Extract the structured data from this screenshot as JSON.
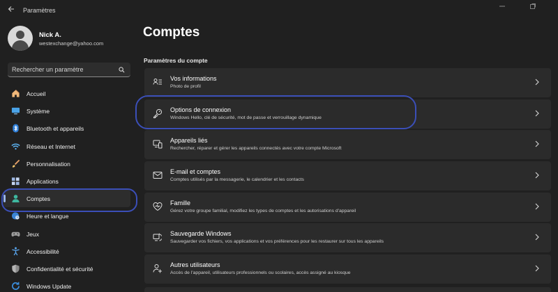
{
  "window": {
    "title": "Paramètres"
  },
  "user": {
    "name": "Nick A.",
    "email": "westexchange@yahoo.com"
  },
  "search": {
    "placeholder": "Rechercher un paramètre"
  },
  "nav": {
    "items": [
      {
        "label": "Accueil",
        "icon": "home-icon"
      },
      {
        "label": "Système",
        "icon": "monitor-icon"
      },
      {
        "label": "Bluetooth et appareils",
        "icon": "bluetooth-icon"
      },
      {
        "label": "Réseau et Internet",
        "icon": "wifi-icon"
      },
      {
        "label": "Personnalisation",
        "icon": "brush-icon"
      },
      {
        "label": "Applications",
        "icon": "apps-icon"
      },
      {
        "label": "Comptes",
        "icon": "person-icon",
        "selected": true
      },
      {
        "label": "Heure et langue",
        "icon": "clock-globe-icon"
      },
      {
        "label": "Jeux",
        "icon": "gamepad-icon"
      },
      {
        "label": "Accessibilité",
        "icon": "accessibility-icon"
      },
      {
        "label": "Confidentialité et sécurité",
        "icon": "shield-icon"
      },
      {
        "label": "Windows Update",
        "icon": "update-icon"
      }
    ]
  },
  "main": {
    "title": "Comptes",
    "section_title": "Paramètres du compte",
    "cards": [
      {
        "title": "Vos informations",
        "subtitle": "Photo de profil",
        "icon": "person-card-icon"
      },
      {
        "title": "Options de connexion",
        "subtitle": "Windows Hello, clé de sécurité, mot de passe et verrouillage dynamique",
        "icon": "key-icon"
      },
      {
        "title": "Appareils liés",
        "subtitle": "Rechercher, réparer et gérer les appareils connectés avec votre compte Microsoft",
        "icon": "devices-icon"
      },
      {
        "title": "E-mail et comptes",
        "subtitle": "Comptes utilisés par la messagerie, le calendrier et les contacts",
        "icon": "mail-icon"
      },
      {
        "title": "Famille",
        "subtitle": "Gérez votre groupe familial, modifiez les types de comptes et les autorisations d'appareil",
        "icon": "family-heart-icon"
      },
      {
        "title": "Sauvegarde Windows",
        "subtitle": "Sauvegarder vos fichiers, vos applications et vos préférences pour les restaurer sur tous les appareils",
        "icon": "backup-icon"
      },
      {
        "title": "Autres utilisateurs",
        "subtitle": "Accès de l'appareil, utilisateurs professionnels ou scolaires, accès assigné au kiosque",
        "icon": "add-user-icon"
      }
    ]
  },
  "colors": {
    "background": "#202020",
    "card": "#2b2b2b",
    "accent": "#9ab6e8",
    "highlight_annotation": "#3b4fb8"
  }
}
